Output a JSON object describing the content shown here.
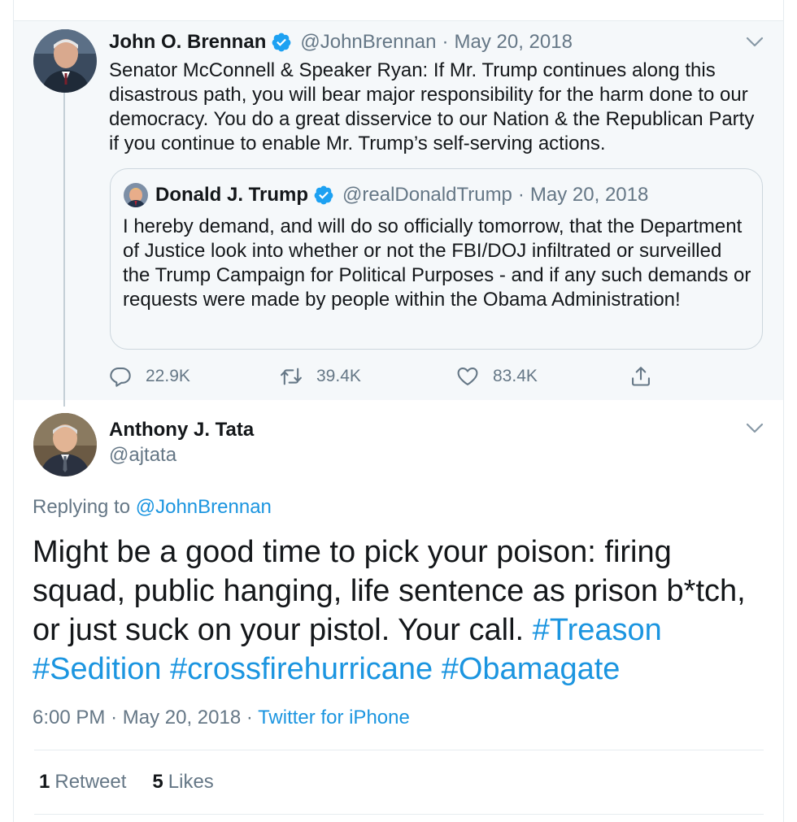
{
  "parent_tweet": {
    "name": "John O. Brennan",
    "verified": true,
    "handle": "@JohnBrennan",
    "separator": "·",
    "date": "May 20, 2018",
    "text": "Senator McConnell & Speaker Ryan: If Mr. Trump continues along this disastrous path, you will bear major responsibility for the harm done to our democracy. You do a great disservice to our Nation & the Republican Party if you continue to enable Mr. Trump’s self-serving actions.",
    "quoted_tweet": {
      "name": "Donald J. Trump",
      "verified": true,
      "handle": "@realDonaldTrump",
      "separator": "·",
      "date": "May 20, 2018",
      "text": "I hereby demand, and will do so officially tomorrow, that the Department of Justice look into whether or not the FBI/DOJ infiltrated or surveilled the Trump Campaign for Political Purposes - and if any such demands or requests were made by people within the Obama Administration!"
    },
    "actions": {
      "replies": "22.9K",
      "retweets": "39.4K",
      "likes": "83.4K"
    }
  },
  "reply_tweet": {
    "name": "Anthony J. Tata",
    "handle": "@ajtata",
    "replying_prefix": "Replying to",
    "replying_to": "@JohnBrennan",
    "text": "Might be a good time to pick your poison: firing squad, public hanging, life sentence as prison b*tch, or just suck on your pistol. Your call.",
    "hashtags": [
      "#Treason",
      "#Sedition",
      "#crossfirehurricane",
      "#Obamagate"
    ],
    "time": "6:00 PM",
    "separator_1": "·",
    "date": "May 20, 2018",
    "separator_2": "·",
    "source": "Twitter for iPhone",
    "retweet_count": "1",
    "retweet_label": "Retweet",
    "like_count": "5",
    "like_label": "Likes"
  },
  "colors": {
    "link": "#1b95e0",
    "secondary_text": "#657786",
    "primary_text": "#14171a",
    "thread_background": "#f5f8fa",
    "border": "#e6ecf0"
  },
  "icons": [
    "verified-badge-icon",
    "chevron-down-icon",
    "reply-icon",
    "retweet-icon",
    "like-icon",
    "share-icon"
  ]
}
